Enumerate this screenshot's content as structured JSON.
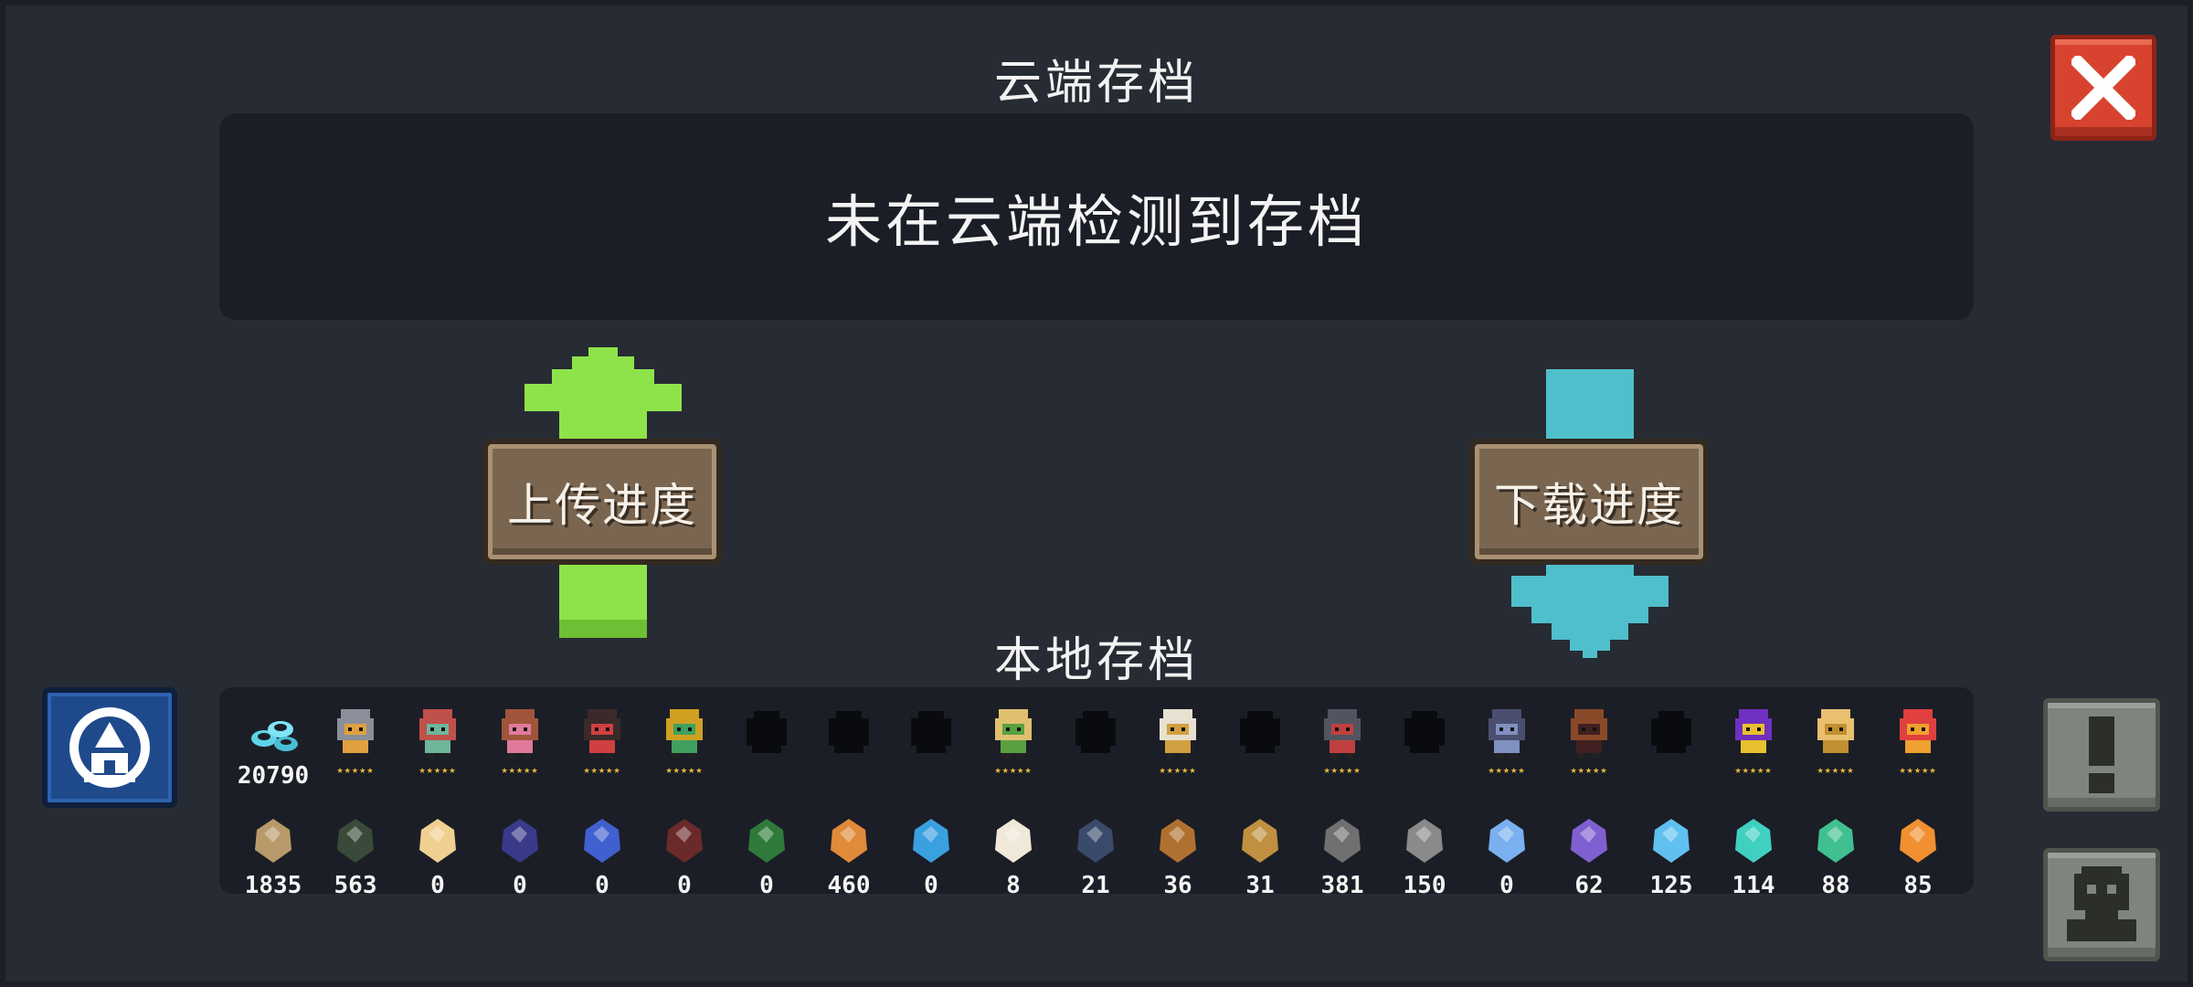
{
  "cloud_title": "云端存档",
  "cloud_message": "未在云端检测到存档",
  "upload_label": "上传进度",
  "download_label": "下载进度",
  "local_title": "本地存档",
  "colors": {
    "upload_arrow": "#8ee34a",
    "download_arrow": "#4fbfcc",
    "close_button": "#d8432f"
  },
  "gem_count": "20790",
  "characters": [
    {
      "icon": "knight-character-icon",
      "unlocked": true,
      "stars": "★★★★★"
    },
    {
      "icon": "rogue-character-icon",
      "unlocked": true,
      "stars": "★★★★★"
    },
    {
      "icon": "witch-character-icon",
      "unlocked": true,
      "stars": "★★★★★"
    },
    {
      "icon": "assassin-character-icon",
      "unlocked": true,
      "stars": "★★★★★"
    },
    {
      "icon": "engineer-character-icon",
      "unlocked": true,
      "stars": "★★★★★"
    },
    {
      "icon": "locked-character-icon",
      "unlocked": false,
      "stars": ""
    },
    {
      "icon": "locked-character-icon",
      "unlocked": false,
      "stars": ""
    },
    {
      "icon": "locked-character-icon",
      "unlocked": false,
      "stars": ""
    },
    {
      "icon": "elf-character-icon",
      "unlocked": true,
      "stars": "★★★★★"
    },
    {
      "icon": "locked-character-icon",
      "unlocked": false,
      "stars": ""
    },
    {
      "icon": "priest-character-icon",
      "unlocked": true,
      "stars": "★★★★★"
    },
    {
      "icon": "locked-character-icon",
      "unlocked": false,
      "stars": ""
    },
    {
      "icon": "robot-character-icon",
      "unlocked": true,
      "stars": "★★★★★"
    },
    {
      "icon": "locked-character-icon",
      "unlocked": false,
      "stars": ""
    },
    {
      "icon": "werewolf-character-icon",
      "unlocked": true,
      "stars": "★★★★★"
    },
    {
      "icon": "officer-character-icon",
      "unlocked": true,
      "stars": "★★★★★"
    },
    {
      "icon": "locked-character-icon",
      "unlocked": false,
      "stars": ""
    },
    {
      "icon": "wizard-character-icon",
      "unlocked": true,
      "stars": "★★★★★"
    },
    {
      "icon": "taoist-character-icon",
      "unlocked": true,
      "stars": "★★★★★"
    },
    {
      "icon": "demon-character-icon",
      "unlocked": true,
      "stars": "★★★★★"
    }
  ],
  "materials": [
    {
      "icon": "wood-material-icon",
      "count": "1835"
    },
    {
      "icon": "battery-material-icon",
      "count": "563"
    },
    {
      "icon": "holy-book-icon",
      "count": "0"
    },
    {
      "icon": "dark-book-icon",
      "count": "0"
    },
    {
      "icon": "potion-material-icon",
      "count": "0"
    },
    {
      "icon": "wing-material-icon",
      "count": "0"
    },
    {
      "icon": "scroll-material-icon",
      "count": "0"
    },
    {
      "icon": "ore-material-icon",
      "count": "460"
    },
    {
      "icon": "crystal-orb-icon",
      "count": "0"
    },
    {
      "icon": "seed-bag-icon",
      "count": "8"
    },
    {
      "icon": "feather-coin-icon",
      "count": "21"
    },
    {
      "icon": "hammer-material-icon",
      "count": "36"
    },
    {
      "icon": "fish-material-icon",
      "count": "31"
    },
    {
      "icon": "gear-material-icon",
      "count": "381"
    },
    {
      "icon": "iron-ore-icon",
      "count": "150"
    },
    {
      "icon": "blue-gem-icon",
      "count": "0"
    },
    {
      "icon": "purple-shard-icon",
      "count": "62"
    },
    {
      "icon": "cyan-shard-icon",
      "count": "125"
    },
    {
      "icon": "teal-shard-icon",
      "count": "114"
    },
    {
      "icon": "green-shard-icon",
      "count": "88"
    },
    {
      "icon": "orange-shard-icon",
      "count": "85"
    }
  ]
}
